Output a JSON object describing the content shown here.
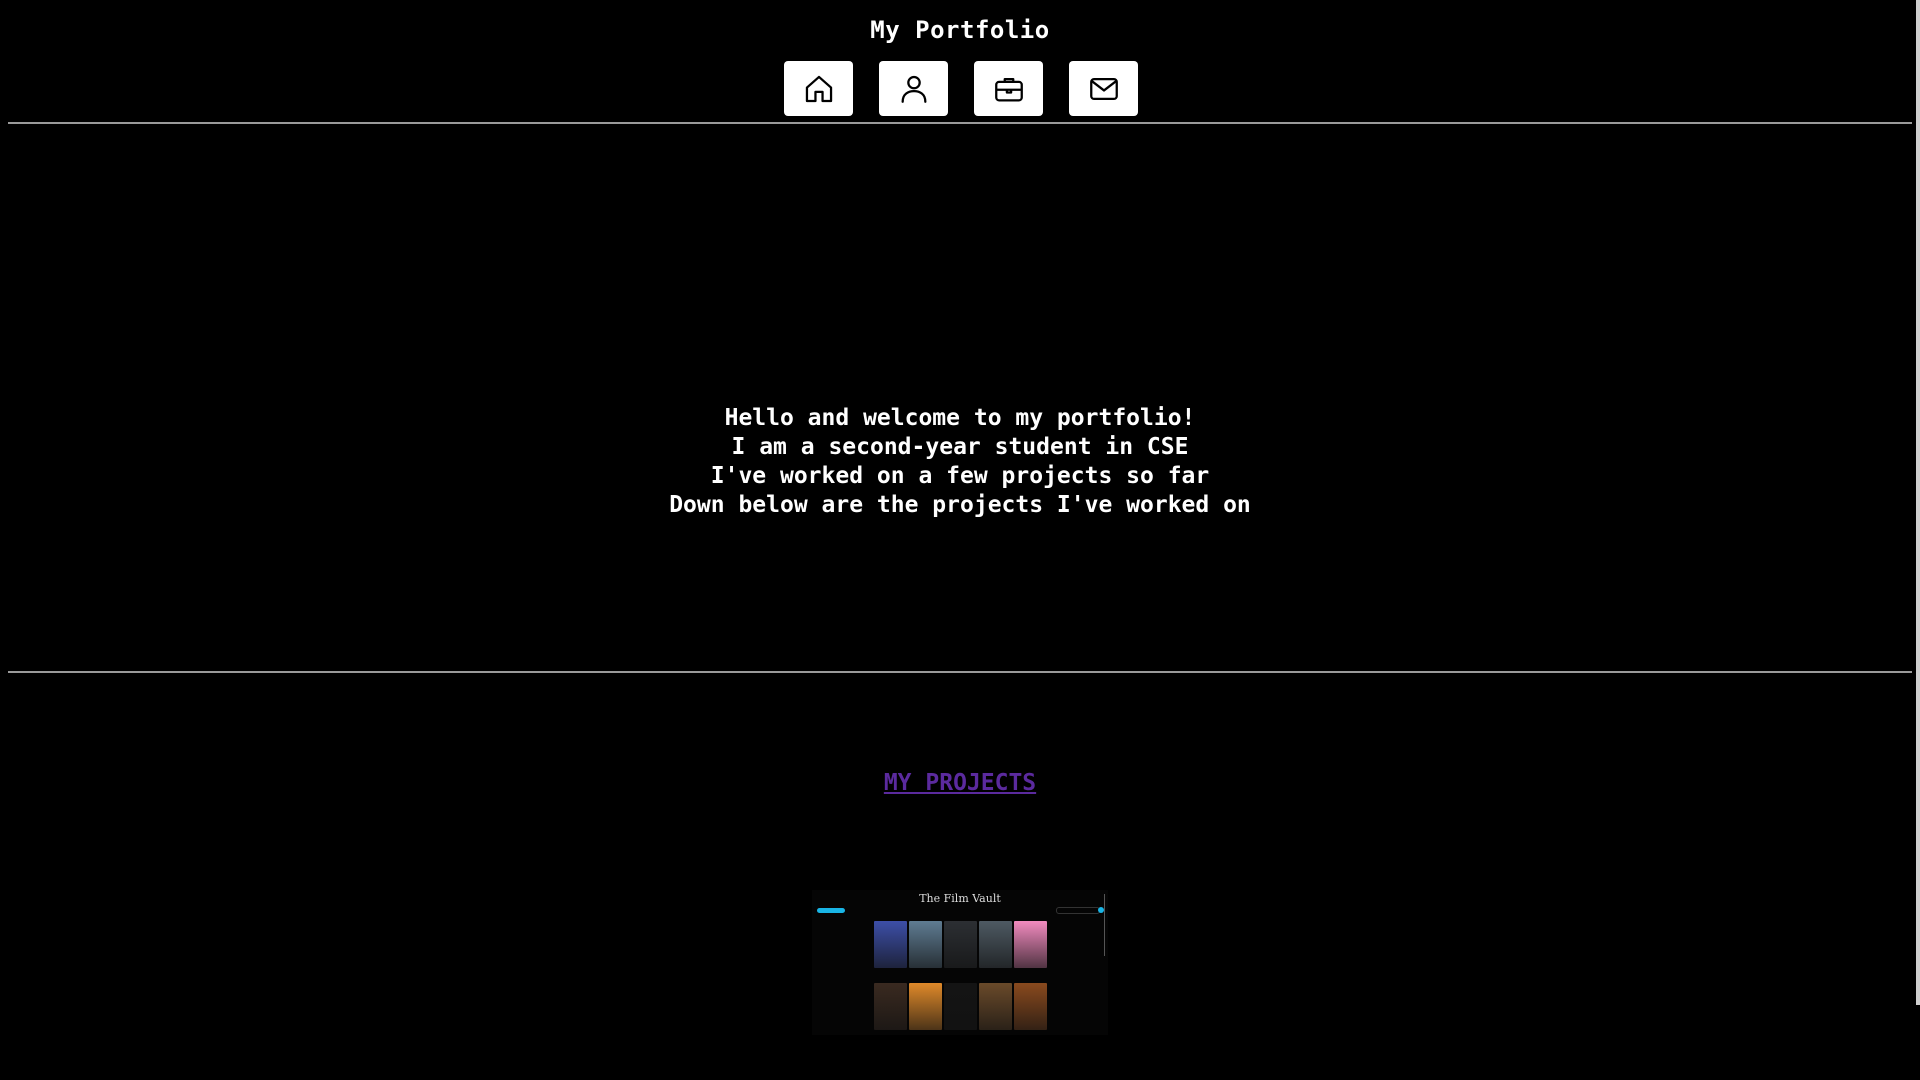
{
  "header": {
    "title": "My Portfolio",
    "nav": [
      {
        "icon": "home-icon",
        "name": "nav-home-button"
      },
      {
        "icon": "user-icon",
        "name": "nav-about-button"
      },
      {
        "icon": "briefcase-icon",
        "name": "nav-projects-button"
      },
      {
        "icon": "mail-icon",
        "name": "nav-contact-button"
      }
    ]
  },
  "intro": {
    "lines": [
      "Hello and welcome to my portfolio!",
      "I am a second-year student in CSE",
      "I've worked on a few projects so far",
      "Down below are the projects I've worked on"
    ]
  },
  "projects": {
    "heading": "MY PROJECTS",
    "heading_color": "#5b2a9e",
    "items": [
      {
        "title": "The Film Vault",
        "accent": "#19b5e6",
        "poster_colors": [
          "#3d4fa8",
          "#5f7c92",
          "#2c2f33",
          "#4e5a63",
          "#f28bbf",
          "#3a2a20",
          "#e08a2a",
          "#141414",
          "#6a4a2a",
          "#8a4a1e"
        ]
      }
    ]
  }
}
